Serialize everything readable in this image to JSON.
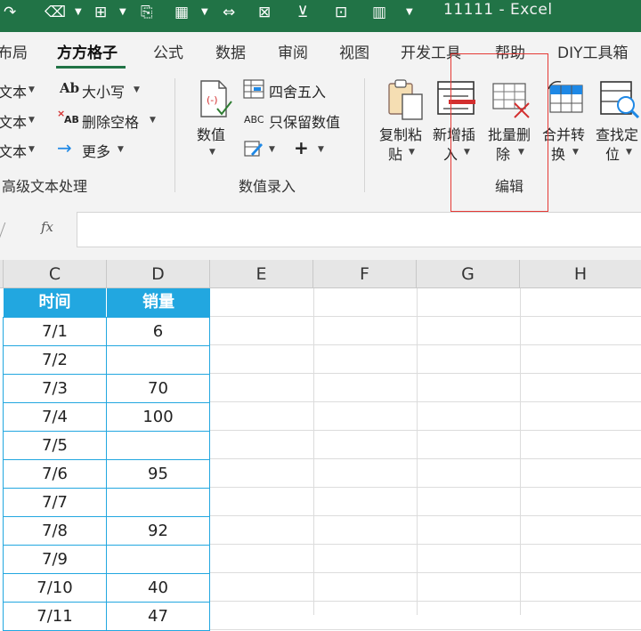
{
  "app": {
    "title": "11111  -  Excel"
  },
  "tabs": [
    {
      "label": "布局"
    },
    {
      "label": "方方格子",
      "active": true
    },
    {
      "label": "公式"
    },
    {
      "label": "数据"
    },
    {
      "label": "审阅"
    },
    {
      "label": "视图"
    },
    {
      "label": "开发工具"
    },
    {
      "label": "帮助"
    },
    {
      "label": "DIY工具箱"
    }
  ],
  "ribbon": {
    "text_group": {
      "label": "高级文本处理",
      "left_items": [
        "文本",
        "文本",
        "文本"
      ],
      "case_label": "大小写",
      "case_icon": "Ab",
      "remove_space_label": "删除空格",
      "remove_space_icon": "AB",
      "more_label": "更多"
    },
    "value_group": {
      "label": "数值录入",
      "value_button": "数值",
      "round_label": "四舍五入",
      "keep_value_label": "只保留数值",
      "keep_value_icon": "ABC"
    },
    "edit_group": {
      "label": "编辑",
      "buttons": [
        {
          "line1": "复制粘",
          "line2": "贴"
        },
        {
          "line1": "新增插",
          "line2": "入"
        },
        {
          "line1": "批量删",
          "line2": "除"
        },
        {
          "line1": "合并转",
          "line2": "换"
        },
        {
          "line1": "查找定",
          "line2": "位"
        }
      ]
    }
  },
  "formula_bar": {
    "fx_label": "fx",
    "value": ""
  },
  "columns": [
    "C",
    "D",
    "E",
    "F",
    "G",
    "H"
  ],
  "table": {
    "headers": [
      "时间",
      "销量"
    ],
    "rows": [
      {
        "date": "7/1",
        "sales": "6"
      },
      {
        "date": "7/2",
        "sales": ""
      },
      {
        "date": "7/3",
        "sales": "70"
      },
      {
        "date": "7/4",
        "sales": "100"
      },
      {
        "date": "7/5",
        "sales": ""
      },
      {
        "date": "7/6",
        "sales": "95"
      },
      {
        "date": "7/7",
        "sales": ""
      },
      {
        "date": "7/8",
        "sales": "92"
      },
      {
        "date": "7/9",
        "sales": ""
      },
      {
        "date": "7/10",
        "sales": "40"
      },
      {
        "date": "7/11",
        "sales": "47"
      }
    ]
  },
  "colors": {
    "excel_green": "#217346",
    "table_header": "#22a7e0",
    "table_border": "#22a7e0",
    "highlight": "#e53935"
  }
}
